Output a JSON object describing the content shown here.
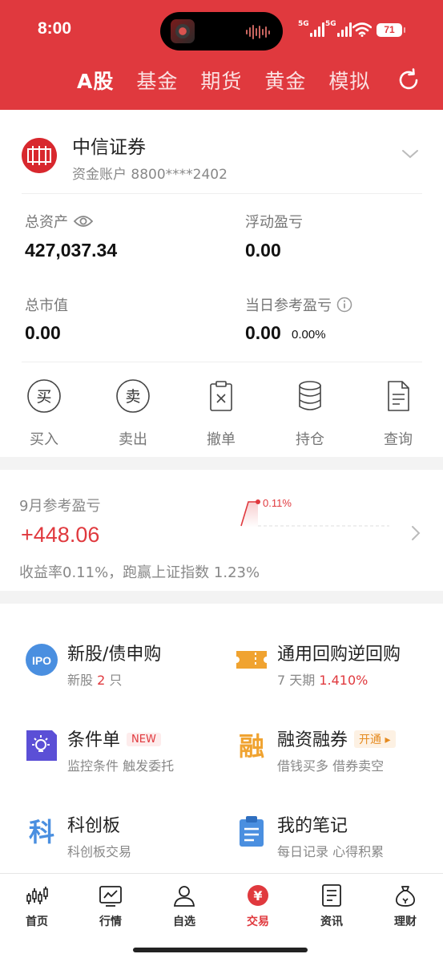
{
  "status_bar": {
    "time": "8:00",
    "signal1_label": "5G",
    "signal2_label": "5G",
    "battery": "71"
  },
  "top_tabs": [
    "A股",
    "基金",
    "期货",
    "黄金",
    "模拟"
  ],
  "active_tab": "A股",
  "account": {
    "broker_name": "中信证券",
    "account_label": "资金账户 8800****2402"
  },
  "metrics": {
    "total_assets_label": "总资产",
    "total_assets_value": "427,037.34",
    "floating_pl_label": "浮动盈亏",
    "floating_pl_value": "0.00",
    "market_value_label": "总市值",
    "market_value_value": "0.00",
    "daily_pl_label": "当日参考盈亏",
    "daily_pl_value": "0.00",
    "daily_pl_pct": "0.00%"
  },
  "actions": {
    "buy": "买入",
    "buy_glyph": "买",
    "sell": "卖出",
    "sell_glyph": "卖",
    "cancel": "撤单",
    "positions": "持仓",
    "query": "查询"
  },
  "monthly": {
    "title": "9月参考盈亏",
    "amount": "+448.06",
    "description": "收益率0.11%，跑赢上证指数 1.23%",
    "spark_label": "0.11%"
  },
  "services": {
    "ipo": {
      "icon_text": "IPO",
      "name": "新股/债申购",
      "sub_prefix": "新股 ",
      "sub_count": "2",
      "sub_suffix": " 只"
    },
    "repo": {
      "name": "通用回购逆回购",
      "sub_prefix": "7 天期 ",
      "sub_rate": "1.410%"
    },
    "condition": {
      "name": "条件单",
      "badge": "NEW",
      "sub": "监控条件 触发委托"
    },
    "margin": {
      "icon_text": "融",
      "name": "融资融券",
      "badge": "开通",
      "sub": "借钱买多 借券卖空"
    },
    "star": {
      "icon_text": "科",
      "name": "科创板",
      "sub": "科创板交易"
    },
    "notes": {
      "name": "我的笔记",
      "sub": "每日记录 心得积累"
    }
  },
  "bottom_nav": {
    "home": "首页",
    "market": "行情",
    "watchlist": "自选",
    "trade": "交易",
    "trade_glyph": "¥",
    "news": "资讯",
    "wealth": "理财"
  },
  "colors": {
    "brand_red": "#e0393e",
    "repo_orange": "#f0a330",
    "condition_purple": "#5b4fd6",
    "ipo_blue": "#4a8fe0"
  }
}
